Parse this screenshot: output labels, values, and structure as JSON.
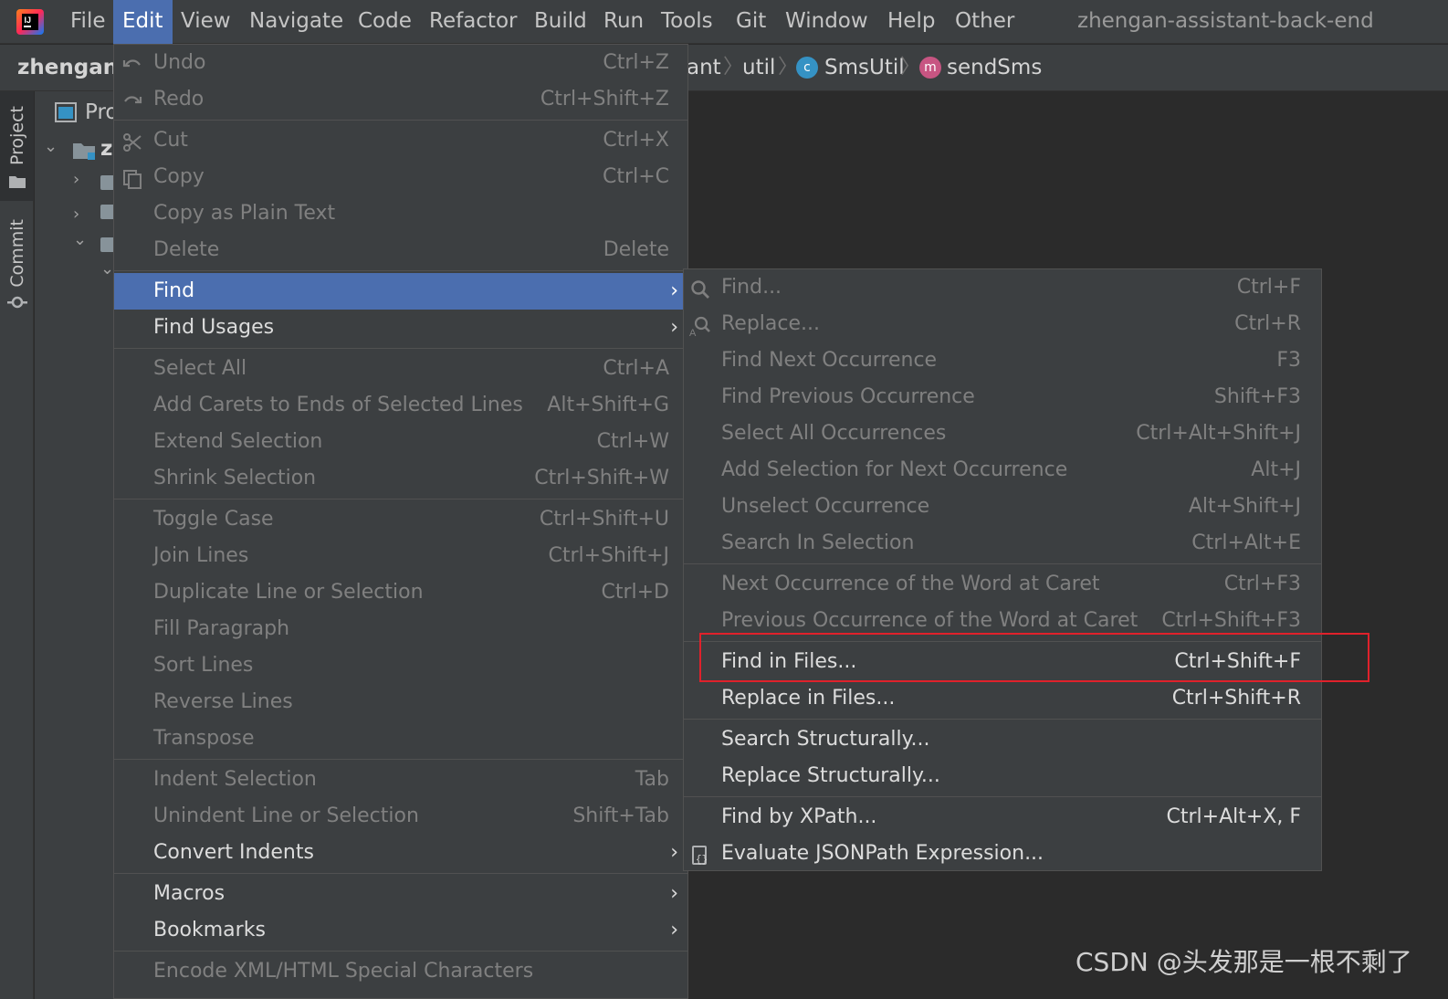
{
  "menubar": {
    "items": [
      "File",
      "Edit",
      "View",
      "Navigate",
      "Code",
      "Refactor",
      "Build",
      "Run",
      "Tools",
      "Git",
      "Window",
      "Help",
      "Other"
    ],
    "active": "Edit",
    "window_title": "zhengan-assistant-back-end"
  },
  "navbar": {
    "project": "zhengan-",
    "crumbs": [
      "ant",
      "util",
      "SmsUtil",
      "sendSms"
    ],
    "class_icon_letter": "c",
    "method_icon_letter": "m"
  },
  "toolwindows": {
    "project_tab": "Project",
    "commit_tab": "Commit",
    "project_header": "Pro",
    "root_label": "z"
  },
  "edit_menu": {
    "items": [
      {
        "label": "Undo",
        "shortcut": "Ctrl+Z",
        "state": "disabled",
        "icon": "undo-icon"
      },
      {
        "label": "Redo",
        "shortcut": "Ctrl+Shift+Z",
        "state": "disabled",
        "icon": "redo-icon"
      },
      {
        "label": "Cut",
        "shortcut": "Ctrl+X",
        "state": "disabled",
        "icon": "cut-icon"
      },
      {
        "label": "Copy",
        "shortcut": "Ctrl+C",
        "state": "disabled",
        "icon": "copy-icon"
      },
      {
        "label": "Copy as Plain Text",
        "shortcut": "",
        "state": "disabled"
      },
      {
        "label": "Delete",
        "shortcut": "Delete",
        "state": "disabled"
      },
      {
        "label": "Find",
        "shortcut": "",
        "state": "selected",
        "submenu": true
      },
      {
        "label": "Find Usages",
        "shortcut": "",
        "state": "enabled",
        "submenu": true
      },
      {
        "label": "Select All",
        "shortcut": "Ctrl+A",
        "state": "disabled"
      },
      {
        "label": "Add Carets to Ends of Selected Lines",
        "shortcut": "Alt+Shift+G",
        "state": "disabled"
      },
      {
        "label": "Extend Selection",
        "shortcut": "Ctrl+W",
        "state": "disabled"
      },
      {
        "label": "Shrink Selection",
        "shortcut": "Ctrl+Shift+W",
        "state": "disabled"
      },
      {
        "label": "Toggle Case",
        "shortcut": "Ctrl+Shift+U",
        "state": "disabled"
      },
      {
        "label": "Join Lines",
        "shortcut": "Ctrl+Shift+J",
        "state": "disabled"
      },
      {
        "label": "Duplicate Line or Selection",
        "shortcut": "Ctrl+D",
        "state": "disabled"
      },
      {
        "label": "Fill Paragraph",
        "shortcut": "",
        "state": "disabled"
      },
      {
        "label": "Sort Lines",
        "shortcut": "",
        "state": "disabled"
      },
      {
        "label": "Reverse Lines",
        "shortcut": "",
        "state": "disabled"
      },
      {
        "label": "Transpose",
        "shortcut": "",
        "state": "disabled"
      },
      {
        "label": "Indent Selection",
        "shortcut": "Tab",
        "state": "disabled"
      },
      {
        "label": "Unindent Line or Selection",
        "shortcut": "Shift+Tab",
        "state": "disabled"
      },
      {
        "label": "Convert Indents",
        "shortcut": "",
        "state": "enabled",
        "submenu": true
      },
      {
        "label": "Macros",
        "shortcut": "",
        "state": "enabled",
        "submenu": true
      },
      {
        "label": "Bookmarks",
        "shortcut": "",
        "state": "enabled",
        "submenu": true
      },
      {
        "label": "Encode XML/HTML Special Characters",
        "shortcut": "",
        "state": "disabled"
      }
    ]
  },
  "find_submenu": {
    "items": [
      {
        "label": "Find...",
        "shortcut": "Ctrl+F",
        "state": "disabled",
        "icon": "search-icon"
      },
      {
        "label": "Replace...",
        "shortcut": "Ctrl+R",
        "state": "disabled",
        "icon": "replace-icon"
      },
      {
        "label": "Find Next Occurrence",
        "shortcut": "F3",
        "state": "disabled"
      },
      {
        "label": "Find Previous Occurrence",
        "shortcut": "Shift+F3",
        "state": "disabled"
      },
      {
        "label": "Select All Occurrences",
        "shortcut": "Ctrl+Alt+Shift+J",
        "state": "disabled"
      },
      {
        "label": "Add Selection for Next Occurrence",
        "shortcut": "Alt+J",
        "state": "disabled"
      },
      {
        "label": "Unselect Occurrence",
        "shortcut": "Alt+Shift+J",
        "state": "disabled"
      },
      {
        "label": "Search In Selection",
        "shortcut": "Ctrl+Alt+E",
        "state": "disabled"
      },
      {
        "label": "Next Occurrence of the Word at Caret",
        "shortcut": "Ctrl+F3",
        "state": "disabled"
      },
      {
        "label": "Previous Occurrence of the Word at Caret",
        "shortcut": "Ctrl+Shift+F3",
        "state": "disabled"
      },
      {
        "label": "Find in Files...",
        "shortcut": "Ctrl+Shift+F",
        "state": "enabled",
        "highlighted": true
      },
      {
        "label": "Replace in Files...",
        "shortcut": "Ctrl+Shift+R",
        "state": "enabled"
      },
      {
        "label": "Search Structurally...",
        "shortcut": "",
        "state": "enabled"
      },
      {
        "label": "Replace Structurally...",
        "shortcut": "",
        "state": "enabled"
      },
      {
        "label": "Find by XPath...",
        "shortcut": "Ctrl+Alt+X, F",
        "state": "enabled"
      },
      {
        "label": "Evaluate JSONPath Expression...",
        "shortcut": "",
        "state": "enabled",
        "icon": "jsonpath-icon"
      }
    ]
  },
  "colors": {
    "menu_bg": "#3c3f41",
    "selection": "#4b6eaf",
    "highlight_border": "#e0212b",
    "editor_bg": "#2b2b2b"
  },
  "watermark": "CSDN @头发那是一根不剩了"
}
